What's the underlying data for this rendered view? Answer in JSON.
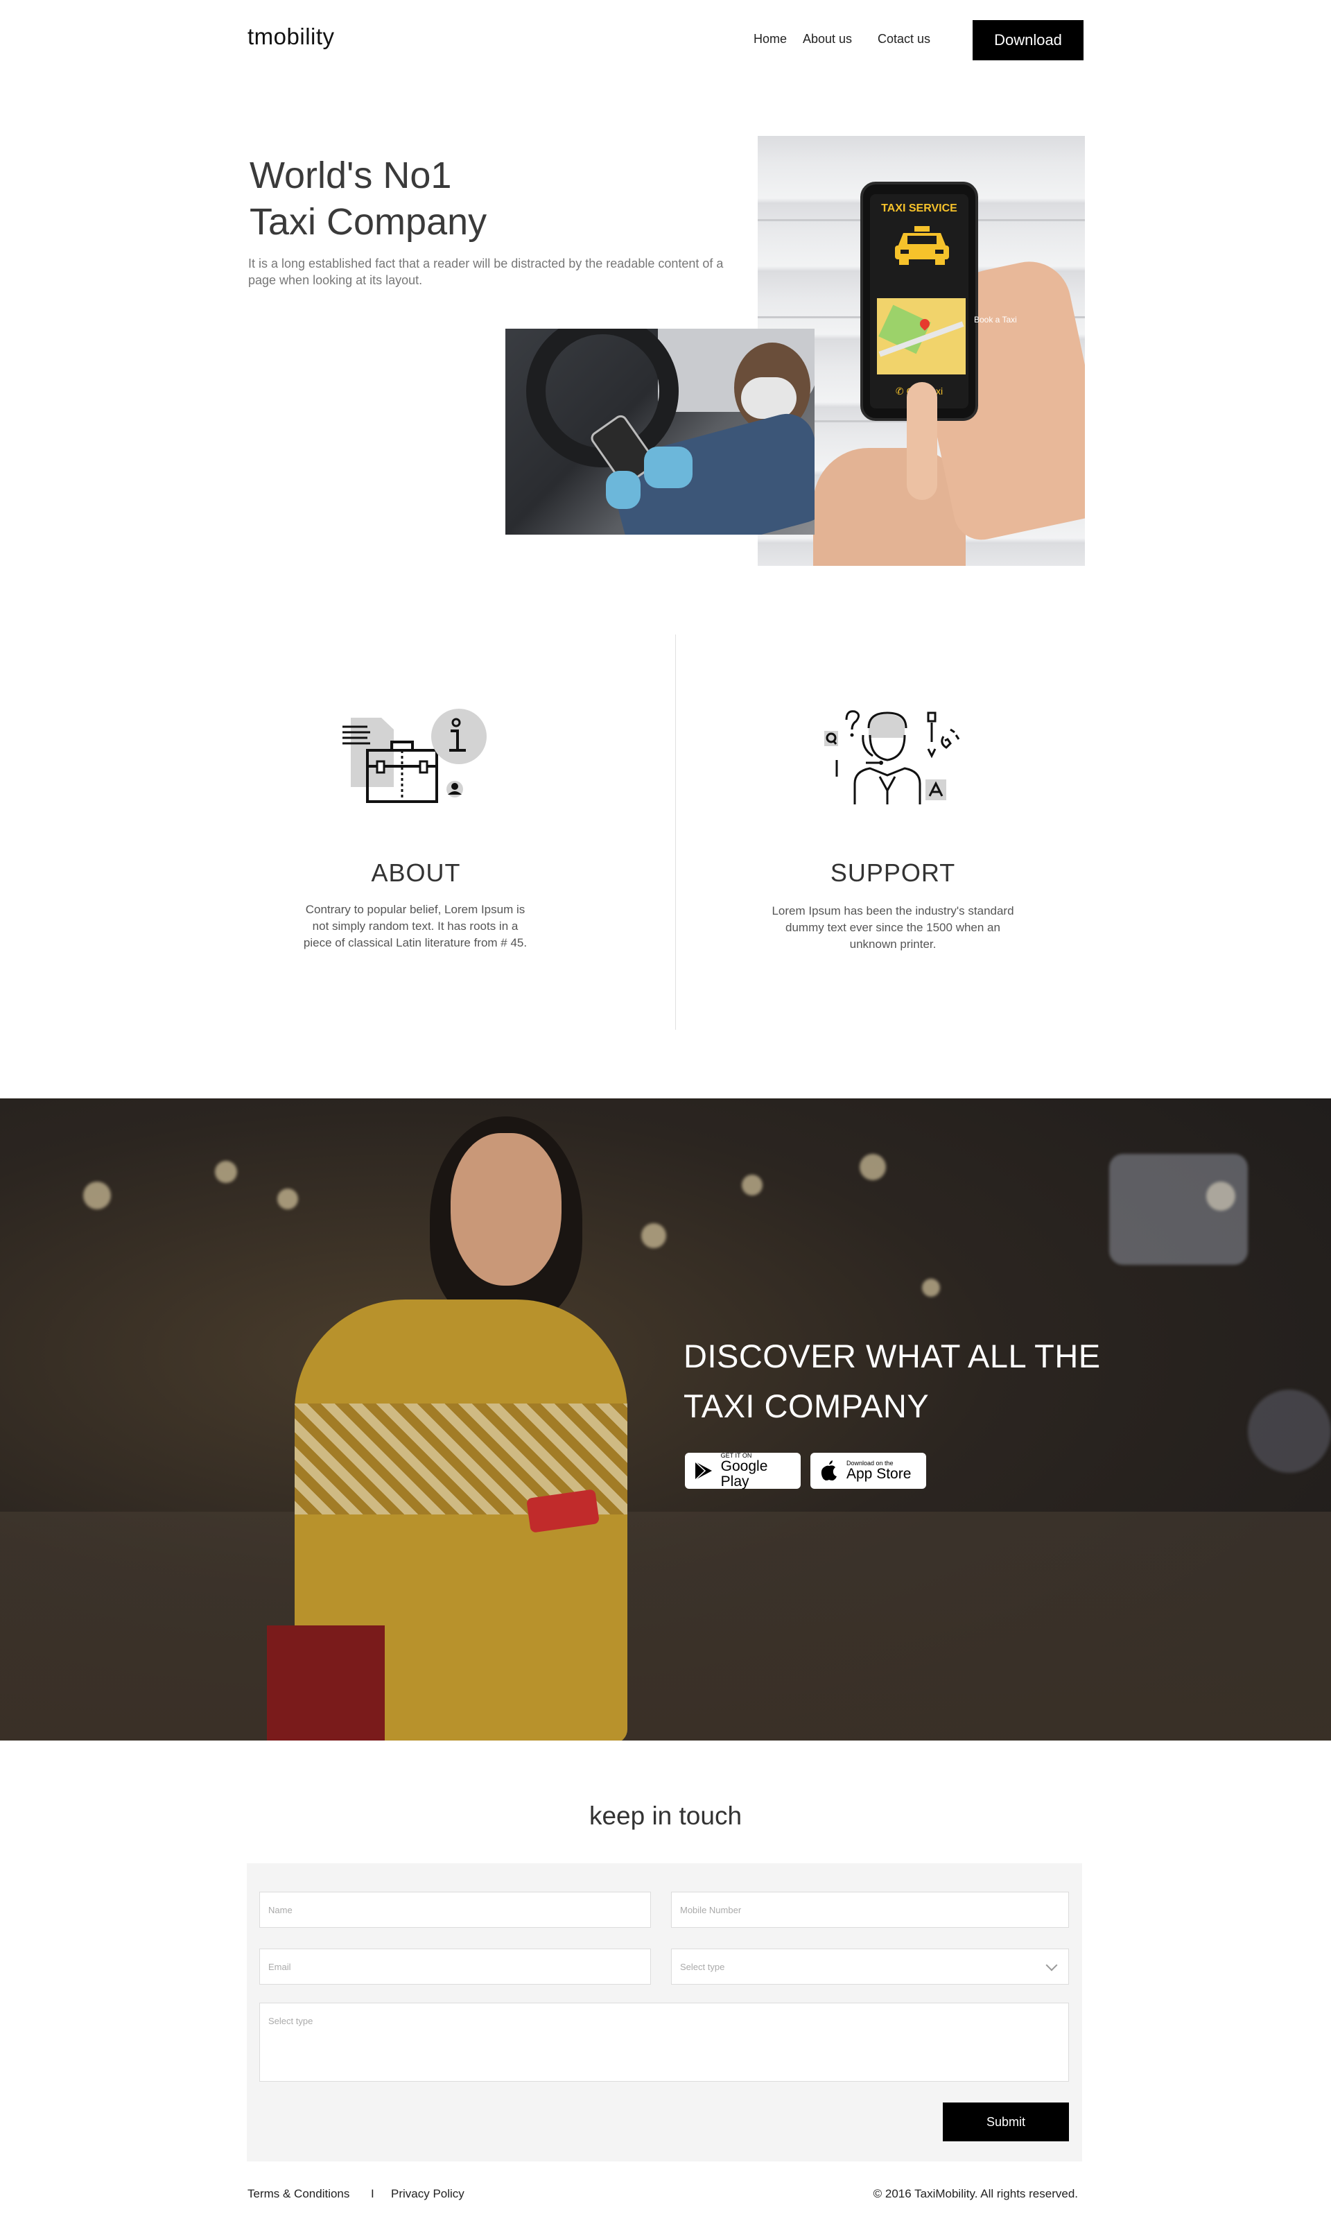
{
  "header": {
    "logo": "tmobility",
    "nav": [
      "Home",
      "About us",
      "Cotact us"
    ],
    "download_label": "Download"
  },
  "hero": {
    "title_line1": "World's No1",
    "title_line2": "Taxi Company",
    "description": "It is a long established fact that a reader will be distracted by the readable content of a page when looking at its layout.",
    "phone_screen": {
      "label": "TAXI SERVICE",
      "call": "Call Taxi",
      "side_text": "Book a Taxi"
    }
  },
  "features": [
    {
      "title": "ABOUT",
      "text": "Contrary to popular belief, Lorem Ipsum is not simply random text. It has roots in a piece of classical Latin literature from # 45.",
      "icon": "briefcase-info-icon"
    },
    {
      "title": "SUPPORT",
      "text": "Lorem Ipsum has been the industry's standard dummy text ever since the 1500 when an unknown printer.",
      "icon": "support-agent-icon"
    }
  ],
  "banner": {
    "title_line1": "DISCOVER WHAT ALL THE",
    "title_line2": "TAXI COMPANY",
    "google_play": {
      "small": "GET IT ON",
      "big": "Google Play"
    },
    "app_store": {
      "small": "Download on the",
      "big": "App Store"
    }
  },
  "contact": {
    "title": "keep in touch",
    "fields": {
      "name_placeholder": "Name",
      "mobile_placeholder": "Mobile Number",
      "email_placeholder": "Email",
      "type_placeholder": "Select type",
      "message_placeholder": "Select type"
    },
    "submit_label": "Submit"
  },
  "footer": {
    "terms": "Terms & Conditions",
    "separator": "I",
    "privacy": "Privacy Policy",
    "copyright": "© 2016 TaxiMobility. All rights reserved."
  },
  "colors": {
    "accent": "#000000",
    "taxi_yellow": "#f6c22b",
    "form_bg": "#f4f4f4"
  }
}
